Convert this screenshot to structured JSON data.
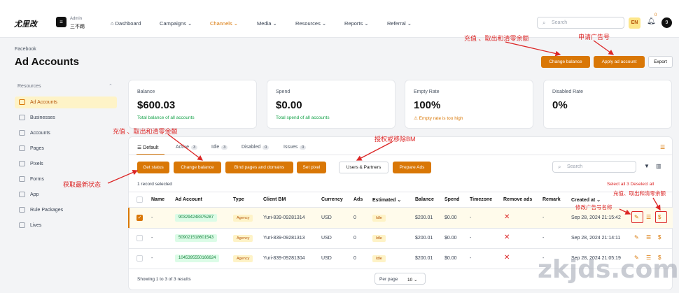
{
  "brand": "尤里改",
  "user": {
    "initial": "≡",
    "role": "Admin",
    "name": "三不踢",
    "avatar": "9"
  },
  "nav": [
    {
      "label": "⌂  Dashboard"
    },
    {
      "label": "Campaigns  ⌄"
    },
    {
      "label": "Channels  ⌄"
    },
    {
      "label": "Media  ⌄"
    },
    {
      "label": "Resources  ⌄"
    },
    {
      "label": "Reports  ⌄"
    },
    {
      "label": "Referral  ⌄"
    }
  ],
  "search": {
    "placeholder": "Search",
    "table_placeholder": "Search"
  },
  "lang": "EN",
  "bell_count": "0",
  "breadcrumb": "Facebook",
  "page_title": "Ad Accounts",
  "header_buttons": {
    "change_balance": "Change balance",
    "apply": "Apply ad account",
    "export": "Export"
  },
  "annotations": {
    "top_change": "充值 、取出和清零余额",
    "top_apply": "申请广告号",
    "tabs_change": "充值 、取出和清零余额",
    "partners": "授权或移除BM",
    "status": "获取最新状态",
    "row_actions": "充值、取出和清零余额",
    "rename": "修改广告号名称"
  },
  "sidebar": {
    "heading": "Resources",
    "items": [
      {
        "label": "Ad Accounts"
      },
      {
        "label": "Businesses"
      },
      {
        "label": "Accounts"
      },
      {
        "label": "Pages"
      },
      {
        "label": "Pixels"
      },
      {
        "label": "Forms"
      },
      {
        "label": "App"
      },
      {
        "label": "Rule Packages"
      },
      {
        "label": "Lives"
      }
    ]
  },
  "cards": [
    {
      "label": "Balance",
      "value": "$600.03",
      "sub": "Total balance of all accounts"
    },
    {
      "label": "Spend",
      "value": "$0.00",
      "sub": "Total spend of all accounts"
    },
    {
      "label": "Empty Rate",
      "value": "100%",
      "sub": "⚠ Empty rate is too high"
    },
    {
      "label": "Disabled Rate",
      "value": "0%",
      "sub": ""
    }
  ],
  "tabs": [
    {
      "label": "☰  Default",
      "count": ""
    },
    {
      "label": "Active",
      "count": "3"
    },
    {
      "label": "Idle",
      "count": "3"
    },
    {
      "label": "Disabled",
      "count": "0"
    },
    {
      "label": "Issues",
      "count": "0"
    }
  ],
  "toolbar": {
    "get_status": "Get status",
    "change_balance": "Change balance",
    "bind": "Bind pages and domains",
    "pixel": "Set pixel",
    "partners": "Users & Partners",
    "prepare": "Prepare Ads"
  },
  "record_selected": "1 record selected",
  "select_all": "Select all 3   Deselect all",
  "columns": [
    "Name",
    "Ad Account",
    "Type",
    "Client BM",
    "Currency",
    "Ads",
    "Estimated ⌄",
    "Balance",
    "Spend",
    "Timezone",
    "Remove ads",
    "Remark",
    "Created at ⌄"
  ],
  "rows": [
    {
      "name": "-",
      "account": "903294248375287",
      "type": "Agency",
      "bm": "Yuri-839-09281314",
      "currency": "USD",
      "ads": "0",
      "estimated": "Idle",
      "balance": "$200.01",
      "spend": "$0.00",
      "timezone": "-",
      "remark": "-",
      "created": "Sep 28, 2024 21:15:42"
    },
    {
      "name": "-",
      "account": "509021518601543",
      "type": "Agency",
      "bm": "Yuri-839-09281313",
      "currency": "USD",
      "ads": "0",
      "estimated": "Idle",
      "balance": "$200.01",
      "spend": "$0.00",
      "timezone": "-",
      "remark": "-",
      "created": "Sep 28, 2024 21:14:11"
    },
    {
      "name": "-",
      "account": "1045395550166624",
      "type": "Agency",
      "bm": "Yuri-839-09281304",
      "currency": "USD",
      "ads": "0",
      "estimated": "Idle",
      "balance": "$200.01",
      "spend": "$0.00",
      "timezone": "-",
      "remark": "-",
      "created": "Sep 28, 2024 21:05:19"
    }
  ],
  "footer": {
    "showing": "Showing 1 to 3 of 3 results",
    "per_page_label": "Per page",
    "per_page_value": "10  ⌄"
  },
  "watermark": "zkjds.com"
}
